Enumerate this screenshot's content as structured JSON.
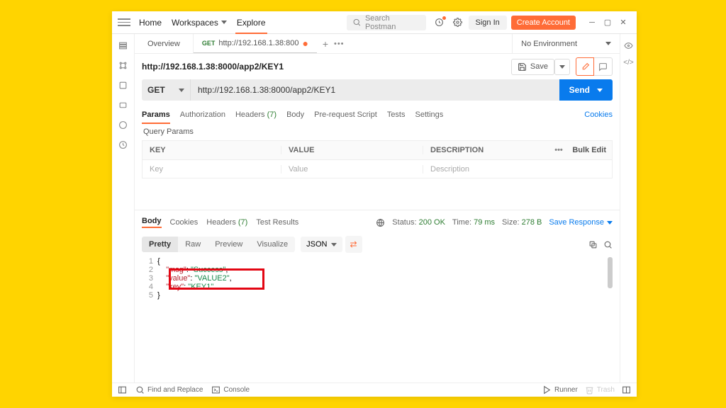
{
  "topbar": {
    "nav": {
      "home": "Home",
      "workspaces": "Workspaces",
      "explore": "Explore"
    },
    "search_placeholder": "Search Postman",
    "sign_in": "Sign In",
    "create_account": "Create Account"
  },
  "tabs": {
    "overview": "Overview",
    "request": {
      "method": "GET",
      "label": "http://192.168.1.38:800"
    },
    "environment": "No Environment"
  },
  "request": {
    "title": "http://192.168.1.38:8000/app2/KEY1",
    "save_label": "Save",
    "method": "GET",
    "url": "http://192.168.1.38:8000/app2/KEY1",
    "send_label": "Send",
    "subtabs": {
      "params": "Params",
      "authorization": "Authorization",
      "headers": "Headers",
      "headers_count": "(7)",
      "body": "Body",
      "pre_request": "Pre-request Script",
      "tests": "Tests",
      "settings": "Settings",
      "cookies": "Cookies"
    },
    "query_params_label": "Query Params",
    "table": {
      "headers": {
        "key": "KEY",
        "value": "VALUE",
        "description": "DESCRIPTION",
        "bulk_edit": "Bulk Edit"
      },
      "placeholder_row": {
        "key": "Key",
        "value": "Value",
        "description": "Description"
      }
    }
  },
  "response": {
    "tabs": {
      "body": "Body",
      "cookies": "Cookies",
      "headers": "Headers",
      "headers_count": "(7)",
      "test_results": "Test Results"
    },
    "status_label": "Status:",
    "status_value": "200 OK",
    "time_label": "Time:",
    "time_value": "79 ms",
    "size_label": "Size:",
    "size_value": "278 B",
    "save_response": "Save Response",
    "view": {
      "pretty": "Pretty",
      "raw": "Raw",
      "preview": "Preview",
      "visualize": "Visualize",
      "format": "JSON"
    },
    "json": {
      "msg_key": "\"msg\"",
      "msg_val": "\"Success\"",
      "value_key": "\"value\"",
      "value_val": "\"VALUE2\"",
      "key_key": "\"key\"",
      "key_val": "\"KEY1\""
    }
  },
  "statusbar": {
    "find": "Find and Replace",
    "console": "Console",
    "runner": "Runner",
    "trash": "Trash"
  }
}
